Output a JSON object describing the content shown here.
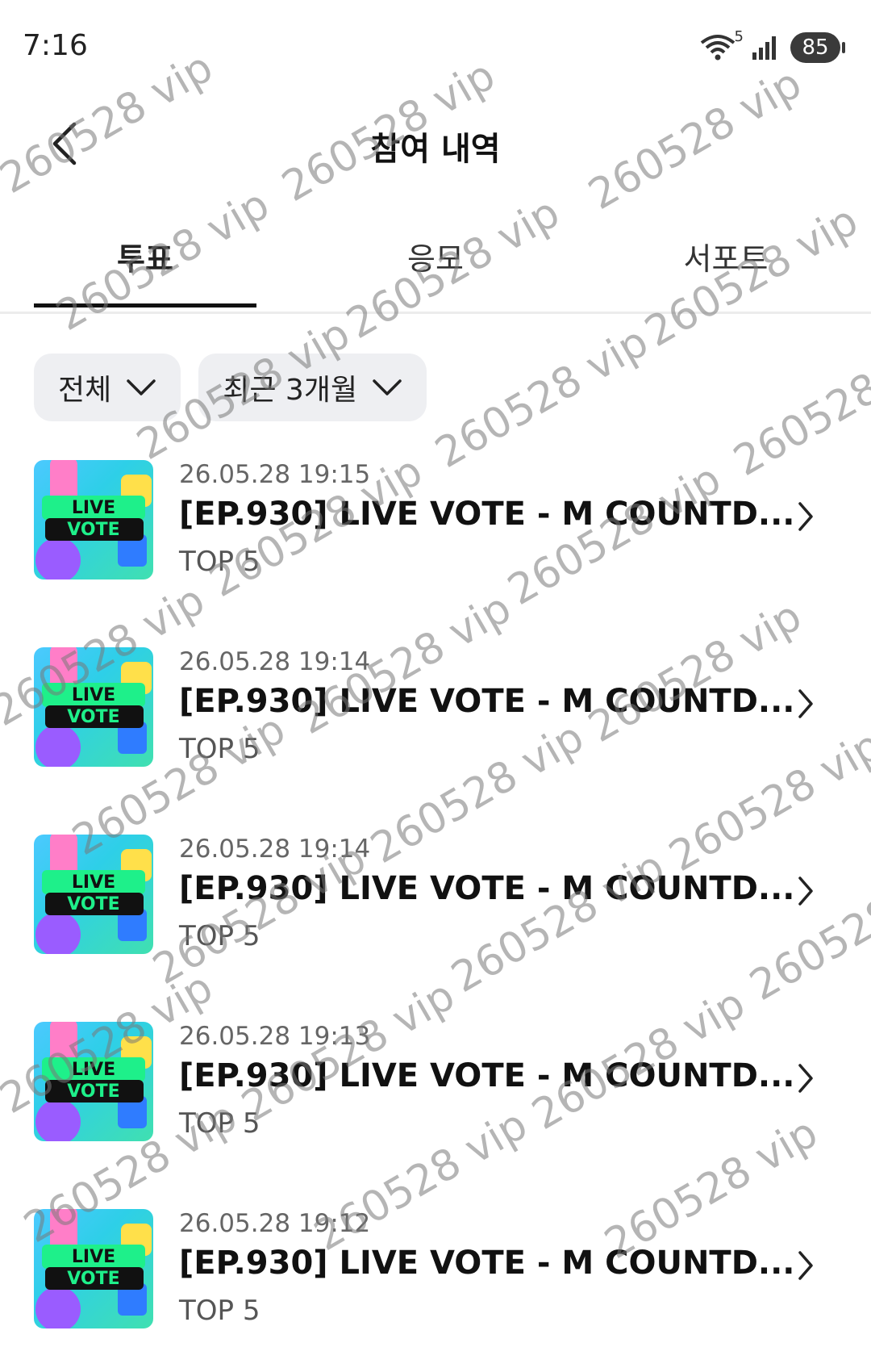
{
  "status_bar": {
    "time": "7:16",
    "battery": "85",
    "network_badge": "5",
    "icons": [
      "wifi-icon",
      "signal-icon",
      "battery-icon"
    ]
  },
  "header": {
    "title": "참여 내역"
  },
  "tabs": [
    {
      "label": "투표",
      "active": true
    },
    {
      "label": "응모",
      "active": false
    },
    {
      "label": "서포트",
      "active": false
    }
  ],
  "filters": [
    {
      "label": "전체"
    },
    {
      "label": "최근 3개월"
    }
  ],
  "items": [
    {
      "date": "26.05.28 19:15",
      "title": "[EP.930] LIVE VOTE - M COUNTD...",
      "sub": "TOP 5",
      "thumb_line1": "LIVE",
      "thumb_line2": "VOTE"
    },
    {
      "date": "26.05.28 19:14",
      "title": "[EP.930] LIVE VOTE - M COUNTD...",
      "sub": "TOP 5",
      "thumb_line1": "LIVE",
      "thumb_line2": "VOTE"
    },
    {
      "date": "26.05.28 19:14",
      "title": "[EP.930] LIVE VOTE - M COUNTD...",
      "sub": "TOP 5",
      "thumb_line1": "LIVE",
      "thumb_line2": "VOTE"
    },
    {
      "date": "26.05.28 19:13",
      "title": "[EP.930] LIVE VOTE - M COUNTD...",
      "sub": "TOP 5",
      "thumb_line1": "LIVE",
      "thumb_line2": "VOTE"
    },
    {
      "date": "26.05.28 19:12",
      "title": "[EP.930] LIVE VOTE - M COUNTD...",
      "sub": "TOP 5",
      "thumb_line1": "LIVE",
      "thumb_line2": "VOTE"
    }
  ],
  "watermark_text": "260528 vip"
}
